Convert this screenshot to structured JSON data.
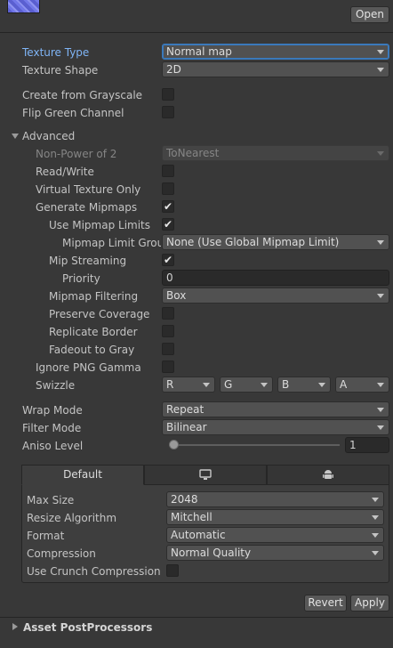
{
  "header": {
    "thumbnail": "normal-map-texture",
    "open_label": "Open"
  },
  "texture_type": {
    "label": "Texture Type",
    "value": "Normal map"
  },
  "texture_shape": {
    "label": "Texture Shape",
    "value": "2D"
  },
  "create_from_grayscale": {
    "label": "Create from Grayscale",
    "checked": false
  },
  "flip_green_channel": {
    "label": "Flip Green Channel",
    "checked": false
  },
  "advanced": {
    "label": "Advanced",
    "non_power_of_2": {
      "label": "Non-Power of 2",
      "value": "ToNearest"
    },
    "read_write": {
      "label": "Read/Write",
      "checked": false
    },
    "virtual_texture_only": {
      "label": "Virtual Texture Only",
      "checked": false
    },
    "generate_mipmaps": {
      "label": "Generate Mipmaps",
      "checked": true,
      "mark": "✔"
    },
    "use_mipmap_limits": {
      "label": "Use Mipmap Limits",
      "checked": true,
      "mark": "✔"
    },
    "mipmap_limit_group": {
      "label": "Mipmap Limit Group",
      "value": "None (Use Global Mipmap Limit)"
    },
    "mip_streaming": {
      "label": "Mip Streaming",
      "checked": true,
      "mark": "✔"
    },
    "priority": {
      "label": "Priority",
      "value": "0"
    },
    "mipmap_filtering": {
      "label": "Mipmap Filtering",
      "value": "Box"
    },
    "preserve_coverage": {
      "label": "Preserve Coverage",
      "checked": false
    },
    "replicate_border": {
      "label": "Replicate Border",
      "checked": false
    },
    "fadeout_to_gray": {
      "label": "Fadeout to Gray",
      "checked": false
    },
    "ignore_png_gamma": {
      "label": "Ignore PNG Gamma",
      "checked": false
    },
    "swizzle": {
      "label": "Swizzle",
      "r": "R",
      "g": "G",
      "b": "B",
      "a": "A"
    }
  },
  "wrap_mode": {
    "label": "Wrap Mode",
    "value": "Repeat"
  },
  "filter_mode": {
    "label": "Filter Mode",
    "value": "Bilinear"
  },
  "aniso_level": {
    "label": "Aniso Level",
    "value": "1",
    "fraction": 0.0
  },
  "platform": {
    "tabs": [
      {
        "label": "Default",
        "active": true
      },
      {
        "icon": "monitor-icon",
        "active": false
      },
      {
        "icon": "android-icon",
        "active": false
      }
    ],
    "max_size": {
      "label": "Max Size",
      "value": "2048"
    },
    "resize_algorithm": {
      "label": "Resize Algorithm",
      "value": "Mitchell"
    },
    "format": {
      "label": "Format",
      "value": "Automatic"
    },
    "compression": {
      "label": "Compression",
      "value": "Normal Quality"
    },
    "use_crunch_compression": {
      "label": "Use Crunch Compression",
      "checked": false
    }
  },
  "footer": {
    "revert_label": "Revert",
    "apply_label": "Apply"
  },
  "asset_postprocessors": {
    "label": "Asset PostProcessors"
  }
}
